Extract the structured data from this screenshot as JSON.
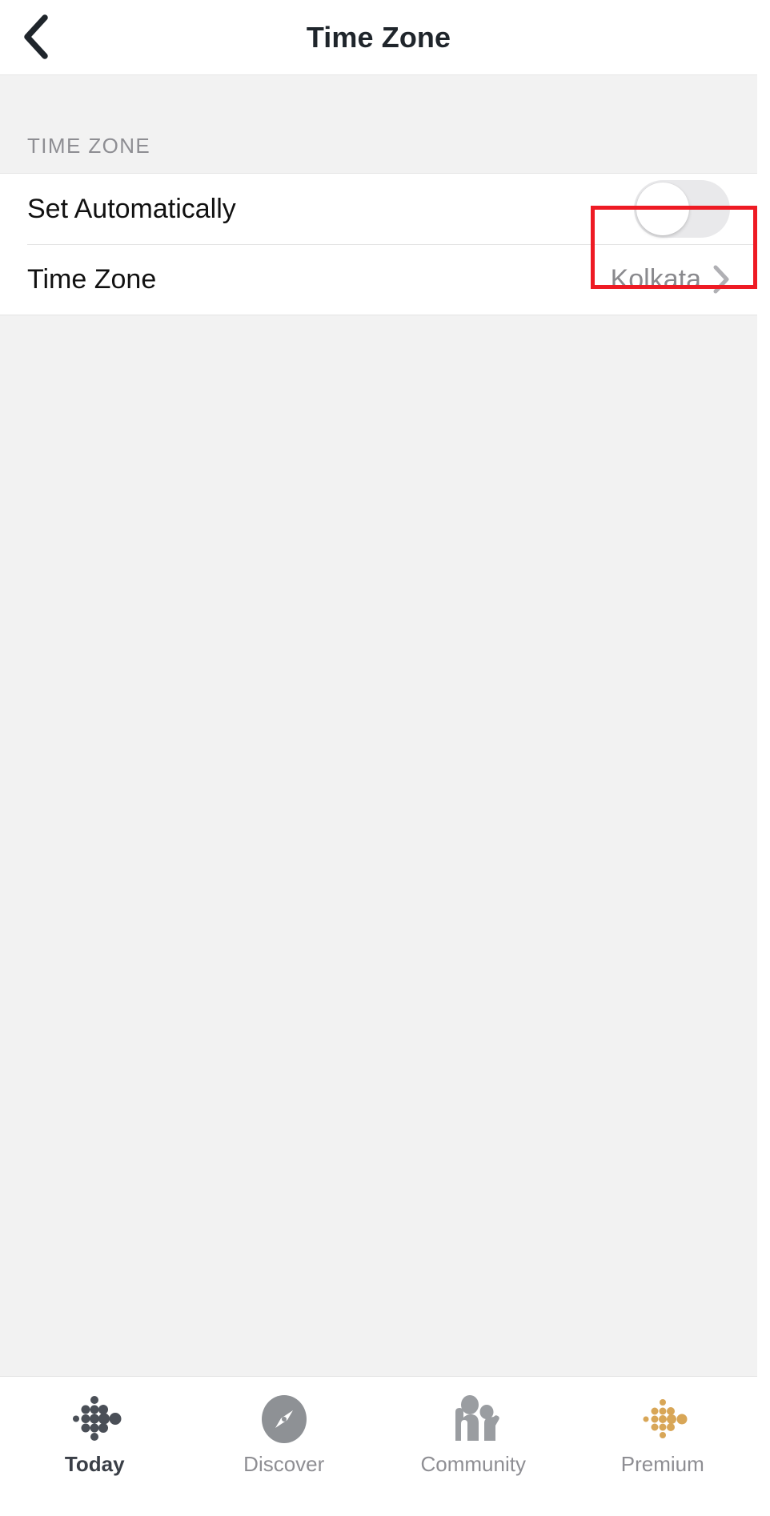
{
  "navbar": {
    "back_icon": "chevron-left-icon",
    "title": "Time Zone"
  },
  "section": {
    "header_label": "TIME ZONE",
    "rows": [
      {
        "label": "Set Automatically",
        "control": "toggle",
        "toggle_state": "off",
        "highlighted": true
      },
      {
        "label": "Time Zone",
        "value": "Kolkata",
        "control": "chevron-right-icon",
        "highlighted": false
      }
    ]
  },
  "annotation": {
    "color": "#ee1b24",
    "target": "set-automatically-toggle"
  },
  "tabbar": {
    "tabs": [
      {
        "label": "Today",
        "icon": "fitbit-dots-icon",
        "active": true
      },
      {
        "label": "Discover",
        "icon": "compass-icon",
        "active": false
      },
      {
        "label": "Community",
        "icon": "people-icon",
        "active": false
      },
      {
        "label": "Premium",
        "icon": "fitbit-premium-dots-icon",
        "active": false
      }
    ]
  },
  "colors": {
    "page_background": "#f2f2f2",
    "row_background": "#ffffff",
    "primary_text": "#111111",
    "secondary_text": "#8a8a8e",
    "toggle_off_track": "#e9e9eb",
    "premium_gold": "#d4a košt"
  }
}
